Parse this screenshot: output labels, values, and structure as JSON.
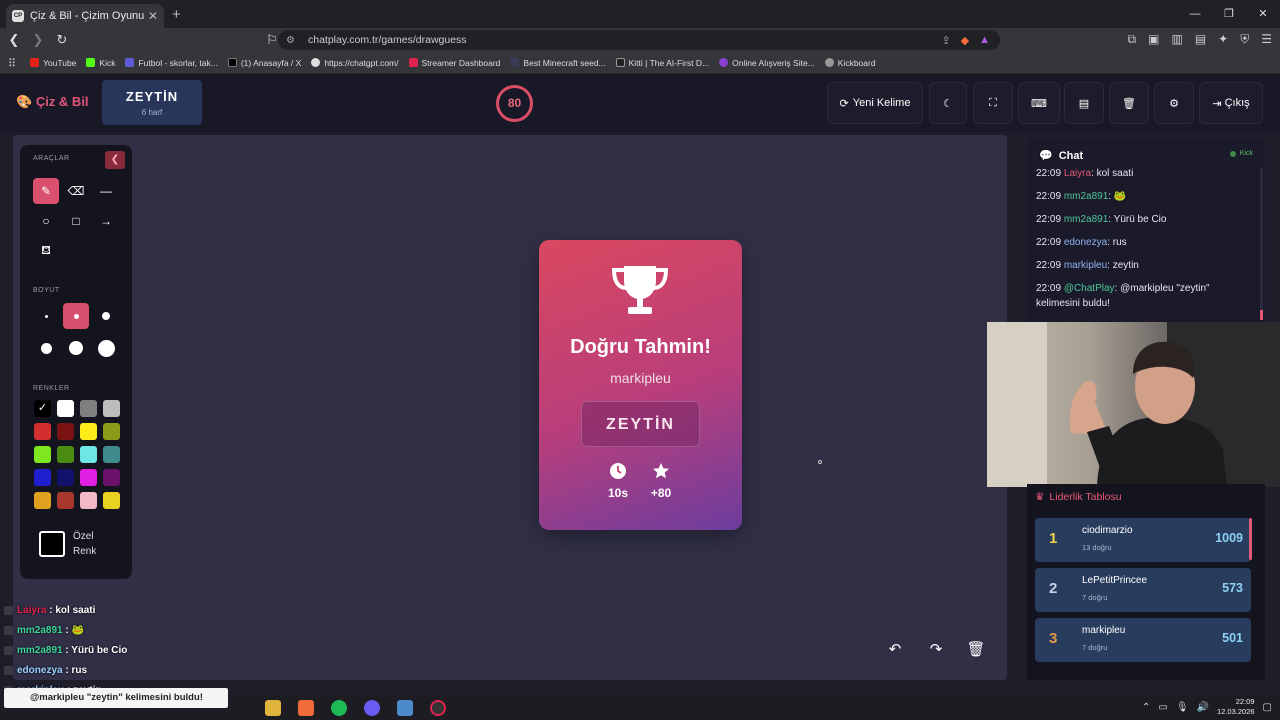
{
  "browser": {
    "tab_title": "Çiz & Bil - Çizim Oyunu",
    "tab_favicon": "CP",
    "url": "chatplay.com.tr/games/drawguess",
    "bookmarks": [
      "YouTube",
      "Kick",
      "Futbol - skorlar, tak...",
      "(1) Anasayfa / X",
      "https://chatgpt.com/",
      "Streamer Dashboard",
      "Best Minecraft seed...",
      "Kitti | The AI-First D...",
      "Online Alışveriş Site...",
      "Kickboard"
    ]
  },
  "header": {
    "logo": "Çiz & Bil",
    "word": "ZEYTİN",
    "word_hint": "6 harf",
    "timer": "80",
    "new_word": "Yeni Kelime",
    "exit": "Çıkış"
  },
  "tools": {
    "section_tools": "ARAÇLAR",
    "section_size": "BOYUT",
    "section_colors": "RENKLER",
    "custom_color_label": "Özel Renk",
    "colors": [
      "#000000",
      "#ffffff",
      "#7f7f7f",
      "#bdbdbd",
      "#d32f2f",
      "#7a1212",
      "#ffeb1a",
      "#8c9a1a",
      "#7fe71f",
      "#4a8c12",
      "#6fe6e6",
      "#3f8a8a",
      "#1f1fd0",
      "#12126a",
      "#e01fe0",
      "#6a126a",
      "#e0a11f",
      "#a8372e",
      "#f2b8c6",
      "#e8d21f"
    ]
  },
  "result": {
    "title": "Doğru Tahmin!",
    "guesser": "markipleu",
    "word": "ZEYTİN",
    "time": "10s",
    "points": "+80"
  },
  "chat": {
    "title": "Chat",
    "platform": "Kick",
    "messages": [
      {
        "time": "22:09",
        "user": "Laiyra",
        "text": "kol saati",
        "color": "#e05a75"
      },
      {
        "time": "22:09",
        "user": "mm2a891",
        "text": "🐸",
        "color": "#4ec79a"
      },
      {
        "time": "22:09",
        "user": "mm2a891",
        "text": "Yürü be Cio",
        "color": "#4ec79a"
      },
      {
        "time": "22:09",
        "user": "edonezya",
        "text": "rus",
        "color": "#8fb4f0"
      },
      {
        "time": "22:09",
        "user": "markipleu",
        "text": "zeytin",
        "color": "#8fb4f0"
      },
      {
        "time": "22:09",
        "user": "@ChatPlay",
        "text": "@markipleu \"zeytin\" kelimesini buldu!",
        "color": "#4ec79a"
      }
    ]
  },
  "leaderboard": {
    "title": "Liderlik Tablosu",
    "rows": [
      {
        "rank": "1",
        "name": "ciodimarzio",
        "sub": "13 doğru",
        "score": "1009",
        "rank_color": "#f2d34a"
      },
      {
        "rank": "2",
        "name": "LePetitPrincee",
        "sub": "7 doğru",
        "score": "573",
        "rank_color": "#c9d3e6"
      },
      {
        "rank": "3",
        "name": "markipleu",
        "sub": "7 doğru",
        "score": "501",
        "rank_color": "#e29a4a"
      }
    ]
  },
  "overlay": [
    {
      "user": "Laiyra",
      "text": "kol saati",
      "color": "#e0224f"
    },
    {
      "user": "mm2a891",
      "text": "🐸",
      "color": "#3ed49a"
    },
    {
      "user": "mm2a891",
      "text": "Yürü be Cio",
      "color": "#3ed49a"
    },
    {
      "user": "edonezya",
      "text": "rus",
      "color": "#9ad0ff"
    },
    {
      "user": "markipleu",
      "text": "zeytin",
      "color": "#9ad0ff"
    }
  ],
  "taskbar": {
    "notification": "@markipleu \"zeytin\" kelimesini buldu!",
    "time": "22:09",
    "date": "12.03.2026"
  }
}
